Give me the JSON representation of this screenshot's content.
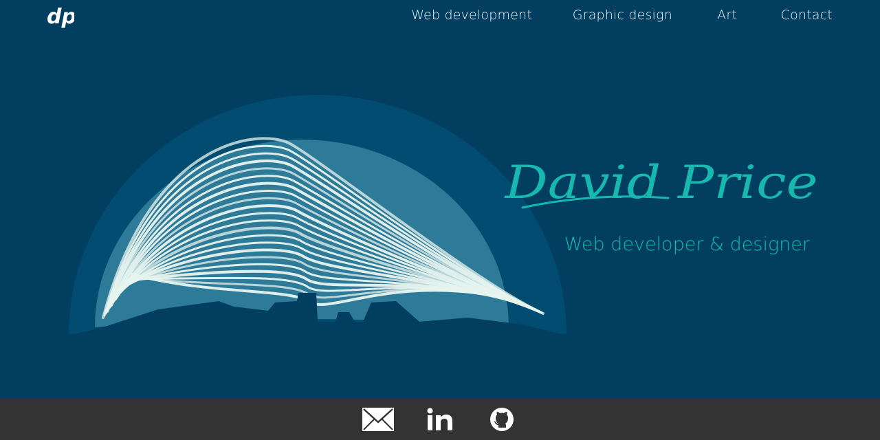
{
  "header": {
    "logo_text": "dp",
    "nav": [
      {
        "label": "Web development"
      },
      {
        "label": "Graphic design"
      },
      {
        "label": "Art"
      },
      {
        "label": "Contact"
      }
    ]
  },
  "hero": {
    "name": "David Price",
    "subtitle": "Web developer & designer"
  },
  "footer": {
    "social_links": [
      {
        "icon": "envelope-icon"
      },
      {
        "icon": "linkedin-icon"
      },
      {
        "icon": "github-icon"
      }
    ]
  },
  "colors": {
    "background": "#013e5f",
    "accent": "#16b8b0",
    "footer": "#333333",
    "nav_text": "#e9f3f6"
  }
}
